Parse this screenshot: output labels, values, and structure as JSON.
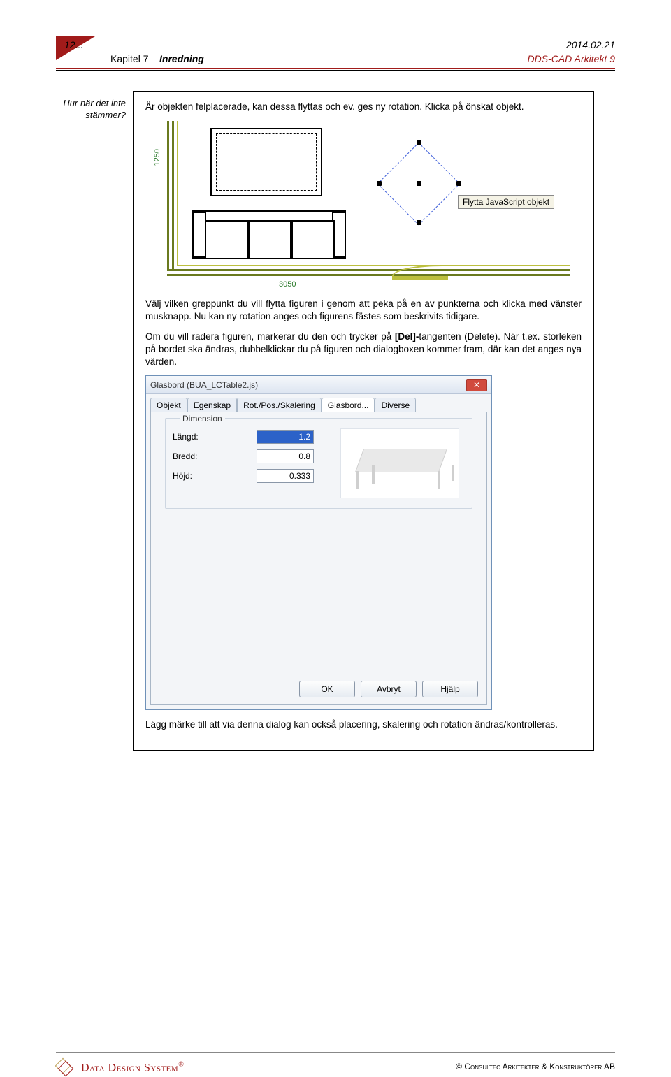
{
  "header": {
    "page_number": "12...",
    "date": "2014.02.21",
    "chapter_prefix": "Kapitel 7",
    "chapter_title": "Inredning",
    "brand": "DDS-CAD Arkitekt 9"
  },
  "marginal_note": "Hur när det inte stämmer?",
  "body": {
    "p1": "Är objekten felplacerade, kan dessa flyttas och ev. ges ny rotation. Klicka på önskat objekt.",
    "p2": "Välj vilken greppunkt du vill flytta figuren i genom att peka på en av punkterna och klicka med vänster musknapp. Nu kan ny rotation anges och figurens fästes som beskrivits tidigare.",
    "p3_a": "Om du vill radera figuren, markerar du den och trycker på ",
    "p3_bold": "[Del]-",
    "p3_b": "tangenten (Delete). När t.ex. storleken på bordet ska ändras, dubbelklickar du på figuren och dialogboxen kommer fram, där kan det anges nya värden.",
    "p4": "Lägg märke till att via denna dialog kan också placering, skalering och rotation ändras/kontrolleras."
  },
  "plan": {
    "tooltip": "Flytta JavaScript objekt",
    "dim_v": "1250",
    "dim_h": "3050"
  },
  "dialog": {
    "title": "Glasbord (BUA_LCTable2.js)",
    "tabs": [
      "Objekt",
      "Egenskap",
      "Rot./Pos./Skalering",
      "Glasbord...",
      "Diverse"
    ],
    "active_tab_index": 3,
    "group_label": "Dimension",
    "fields": {
      "length_label": "Längd:",
      "length_value": "1.2",
      "width_label": "Bredd:",
      "width_value": "0.8",
      "height_label": "Höjd:",
      "height_value": "0.333"
    },
    "buttons": {
      "ok": "OK",
      "cancel": "Avbryt",
      "help": "Hjälp"
    },
    "close_glyph": "✕"
  },
  "footer": {
    "logo_text": "Data Design System",
    "reg": "®",
    "copyright": "©  Consultec Arkitekter & Konstruktörer AB"
  }
}
